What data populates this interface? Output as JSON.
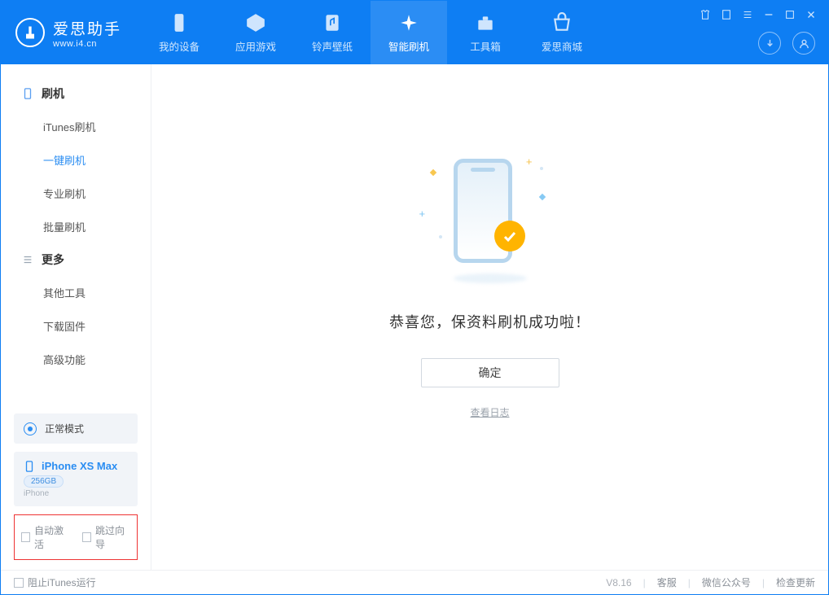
{
  "app": {
    "title": "爱思助手",
    "subtitle": "www.i4.cn"
  },
  "nav": {
    "tabs": [
      {
        "label": "我的设备"
      },
      {
        "label": "应用游戏"
      },
      {
        "label": "铃声壁纸"
      },
      {
        "label": "智能刷机"
      },
      {
        "label": "工具箱"
      },
      {
        "label": "爱思商城"
      }
    ]
  },
  "sidebar": {
    "section1": {
      "title": "刷机",
      "items": [
        "iTunes刷机",
        "一键刷机",
        "专业刷机",
        "批量刷机"
      ]
    },
    "section2": {
      "title": "更多",
      "items": [
        "其他工具",
        "下载固件",
        "高级功能"
      ]
    },
    "status_mode": "正常模式",
    "device": {
      "name": "iPhone XS Max",
      "capacity": "256GB",
      "type": "iPhone"
    },
    "chk_auto_activate": "自动激活",
    "chk_skip_wizard": "跳过向导"
  },
  "main": {
    "success_text": "恭喜您，保资料刷机成功啦！",
    "ok_button": "确定",
    "view_log": "查看日志"
  },
  "statusbar": {
    "block_itunes": "阻止iTunes运行",
    "version": "V8.16",
    "link_service": "客服",
    "link_wechat": "微信公众号",
    "link_update": "检查更新"
  },
  "colors": {
    "primary": "#0e7ef3",
    "accent": "#ffb400"
  }
}
